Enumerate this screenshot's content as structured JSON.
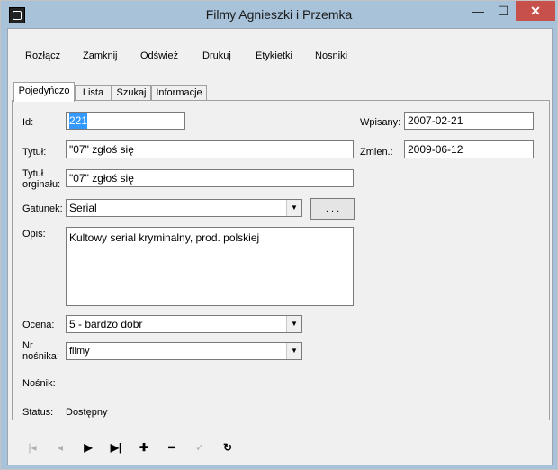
{
  "window": {
    "title": "Filmy Agnieszki i Przemka",
    "minimize": "—",
    "maximize": "☐",
    "close": "✕"
  },
  "toolbar": {
    "disconnect": "Rozłącz",
    "close": "Zamknij",
    "refresh": "Odśwież",
    "print": "Drukuj",
    "labels": "Etykietki",
    "media": "Nosniki"
  },
  "tabs": [
    {
      "label": "Pojedyńczo",
      "active": true
    },
    {
      "label": "Lista",
      "active": false
    },
    {
      "label": "Szukaj",
      "active": false
    },
    {
      "label": "Informacje",
      "active": false
    }
  ],
  "form": {
    "id_label": "Id:",
    "id_value": "221",
    "title_label": "Tytuł:",
    "title_value": "\"07\" zgłoś się",
    "orig_title_label_1": "Tytuł",
    "orig_title_label_2": "orginału:",
    "orig_title_value": "\"07\" zgłoś się",
    "genre_label": "Gatunek:",
    "genre_value": "Serial",
    "genre_more_button": ". . .",
    "desc_label": "Opis:",
    "desc_value": "Kultowy serial kryminalny, prod. polskiej",
    "rating_label": "Ocena:",
    "rating_value": "5 - bardzo dobr",
    "media_no_label_1": "Nr",
    "media_no_label_2": "nośnika:",
    "media_no_value": "filmy",
    "media_label": "Nośnik:",
    "status_label": "Status:",
    "status_value": "Dostępny",
    "entered_label": "Wpisany:",
    "entered_value": "2007-02-21",
    "changed_label": "Zmien.:",
    "changed_value": "2009-06-12"
  },
  "nav": {
    "first": "|◂",
    "prev": "◂",
    "next": "▶",
    "last": "▶|",
    "add": "✚",
    "delete": "━",
    "post": "✓",
    "refresh": "↻"
  }
}
